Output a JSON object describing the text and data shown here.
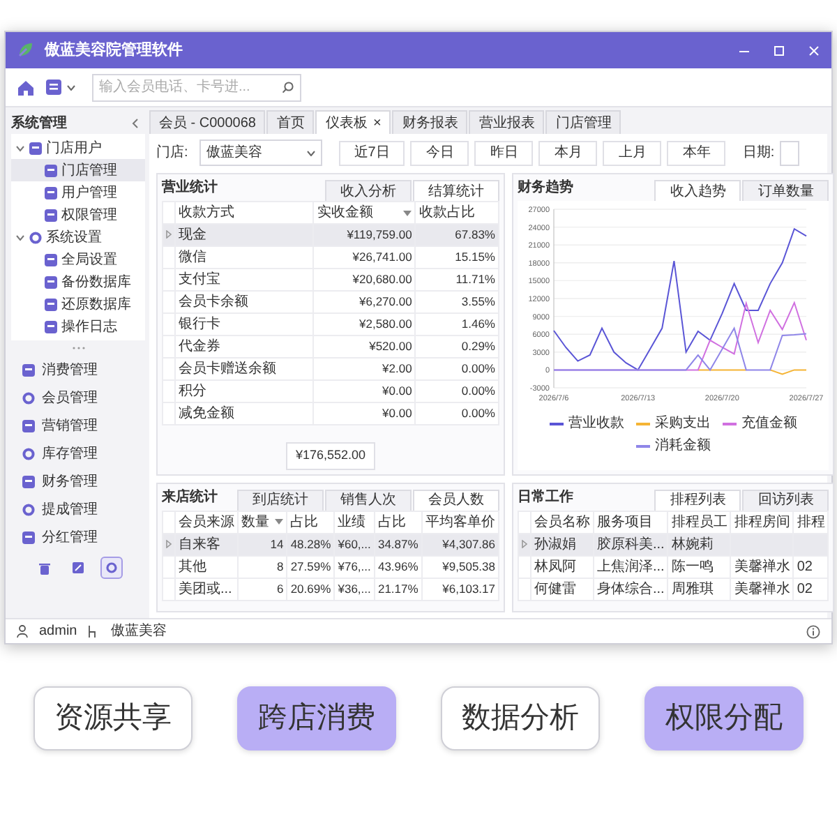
{
  "window": {
    "title": "傲蓝美容院管理软件"
  },
  "toolbar": {
    "search": {
      "placeholder": "输入会员电话、卡号进..."
    }
  },
  "sidebar": {
    "title": "系统管理",
    "tree": [
      {
        "label": "门店用户",
        "expanded": true,
        "selected": false,
        "children": [
          {
            "label": "门店管理",
            "selected": true
          },
          {
            "label": "用户管理",
            "selected": false
          },
          {
            "label": "权限管理",
            "selected": false
          }
        ]
      },
      {
        "label": "系统设置",
        "expanded": true,
        "selected": false,
        "children": [
          {
            "label": "全局设置",
            "selected": false
          },
          {
            "label": "备份数据库",
            "selected": false
          },
          {
            "label": "还原数据库",
            "selected": false
          },
          {
            "label": "操作日志",
            "selected": false
          }
        ]
      }
    ],
    "modules": [
      {
        "label": "消费管理",
        "selected": false
      },
      {
        "label": "会员管理",
        "selected": false
      },
      {
        "label": "营销管理",
        "selected": false
      },
      {
        "label": "库存管理",
        "selected": false
      },
      {
        "label": "财务管理",
        "selected": false
      },
      {
        "label": "提成管理",
        "selected": false
      },
      {
        "label": "分红管理",
        "selected": false
      }
    ],
    "footer_icons": [
      {
        "selected": false
      },
      {
        "selected": false
      },
      {
        "selected": true
      }
    ]
  },
  "doc_tabs": [
    {
      "label": "会员 - C000068",
      "selected": false
    },
    {
      "label": "首页",
      "selected": false
    },
    {
      "label": "仪表板",
      "selected": true,
      "close": "×"
    },
    {
      "label": "财务报表",
      "selected": false
    },
    {
      "label": "营业报表",
      "selected": false
    },
    {
      "label": "门店管理",
      "selected": false
    }
  ],
  "filter": {
    "store_label": "门店:",
    "store_value": "傲蓝美容",
    "ranges": [
      "近7日",
      "今日",
      "昨日",
      "本月",
      "上月",
      "本年"
    ],
    "date_label": "日期:"
  },
  "revenue": {
    "title": "营业统计",
    "tabs": [
      {
        "label": "收入分析",
        "selected": false
      },
      {
        "label": "结算统计",
        "selected": true
      }
    ],
    "columns": [
      {
        "label": "收款方式",
        "sorted": false
      },
      {
        "label": "实收金额",
        "sorted": true
      },
      {
        "label": "收款占比",
        "sorted": false
      }
    ],
    "rows": [
      {
        "selected": true,
        "cells": [
          "现金",
          "¥119,759.00",
          "67.83%"
        ]
      },
      {
        "selected": false,
        "cells": [
          "微信",
          "¥26,741.00",
          "15.15%"
        ]
      },
      {
        "selected": false,
        "cells": [
          "支付宝",
          "¥20,680.00",
          "11.71%"
        ]
      },
      {
        "selected": false,
        "cells": [
          "会员卡余额",
          "¥6,270.00",
          "3.55%"
        ]
      },
      {
        "selected": false,
        "cells": [
          "银行卡",
          "¥2,580.00",
          "1.46%"
        ]
      },
      {
        "selected": false,
        "cells": [
          "代金券",
          "¥520.00",
          "0.29%"
        ]
      },
      {
        "selected": false,
        "cells": [
          "会员卡赠送余额",
          "¥2.00",
          "0.00%"
        ]
      },
      {
        "selected": false,
        "cells": [
          "积分",
          "¥0.00",
          "0.00%"
        ]
      },
      {
        "selected": false,
        "cells": [
          "减免金额",
          "¥0.00",
          "0.00%"
        ]
      }
    ],
    "total": "¥176,552.00"
  },
  "trend": {
    "title": "财务趋势",
    "tabs": [
      {
        "label": "收入趋势",
        "selected": true
      },
      {
        "label": "订单数量",
        "selected": false
      }
    ],
    "chart_data": {
      "type": "line",
      "categories": [
        "2026/7/6",
        null,
        null,
        null,
        null,
        null,
        null,
        "2026/7/13",
        null,
        null,
        null,
        null,
        null,
        null,
        "2026/7/20",
        null,
        null,
        null,
        null,
        null,
        null,
        "2026/7/27"
      ],
      "grid": true,
      "legend": true,
      "ylim": [
        -3000,
        27000
      ],
      "yticks": [
        -3000,
        0,
        3000,
        6000,
        9000,
        12000,
        15000,
        18000,
        21000,
        24000,
        27000
      ],
      "series": [
        {
          "name": "营业收款",
          "color": "#5a55d6",
          "values": [
            6600,
            3800,
            1500,
            2500,
            7000,
            3000,
            1200,
            0,
            3500,
            7000,
            18300,
            3000,
            6500,
            5000,
            9500,
            14500,
            10000,
            10000,
            14500,
            18000,
            23700,
            22500
          ]
        },
        {
          "name": "采购支出",
          "color": "#f5b434",
          "values": [
            null,
            null,
            null,
            null,
            null,
            null,
            null,
            null,
            null,
            null,
            null,
            null,
            0,
            0,
            0,
            0,
            0,
            null,
            0,
            -700,
            0,
            0
          ]
        },
        {
          "name": "充值金额",
          "color": "#d070e0",
          "values": [
            0,
            0,
            0,
            0,
            0,
            0,
            0,
            0,
            0,
            0,
            0,
            0,
            0,
            5000,
            3800,
            2700,
            11200,
            4600,
            10000,
            6800,
            11300,
            5000
          ]
        },
        {
          "name": "消耗金额",
          "color": "#8f86e8",
          "values": [
            0,
            0,
            0,
            0,
            0,
            0,
            0,
            0,
            0,
            0,
            0,
            0,
            2500,
            0,
            3500,
            7000,
            0,
            0,
            0,
            5800,
            5900,
            6100
          ]
        }
      ]
    }
  },
  "visits": {
    "title": "来店统计",
    "tabs": [
      {
        "label": "到店统计",
        "selected": false
      },
      {
        "label": "销售人次",
        "selected": false
      },
      {
        "label": "会员人数",
        "selected": true
      }
    ],
    "columns": [
      {
        "label": "会员来源",
        "sorted": false
      },
      {
        "label": "数量",
        "sorted": true
      },
      {
        "label": "占比",
        "sorted": false
      },
      {
        "label": "业绩",
        "sorted": false
      },
      {
        "label": "占比",
        "sorted": false
      },
      {
        "label": "平均客单价",
        "sorted": false
      }
    ],
    "rows": [
      {
        "selected": true,
        "cells": [
          "自来客",
          "14",
          "48.28%",
          "¥60,...",
          "34.87%",
          "¥4,307.86"
        ]
      },
      {
        "selected": false,
        "cells": [
          "其他",
          "8",
          "27.59%",
          "¥76,...",
          "43.96%",
          "¥9,505.38"
        ]
      },
      {
        "selected": false,
        "cells": [
          "美团或...",
          "6",
          "20.69%",
          "¥36,...",
          "21.17%",
          "¥6,103.17"
        ]
      }
    ]
  },
  "schedule": {
    "title": "日常工作",
    "tabs": [
      {
        "label": "排程列表",
        "selected": true
      },
      {
        "label": "回访列表",
        "selected": false
      }
    ],
    "columns": [
      {
        "label": "会员名称",
        "sorted": false
      },
      {
        "label": "服务项目",
        "sorted": false
      },
      {
        "label": "排程员工",
        "sorted": false
      },
      {
        "label": "排程房间",
        "sorted": false
      },
      {
        "label": "排程",
        "sorted": false
      }
    ],
    "rows": [
      {
        "selected": true,
        "cells": [
          "孙淑娟",
          "胶原科美...",
          "林婉莉",
          null,
          null
        ]
      },
      {
        "selected": false,
        "cells": [
          "林凤阿",
          "上焦润泽...",
          "陈一鸣",
          "美馨禅水",
          "02"
        ]
      },
      {
        "selected": false,
        "cells": [
          "何健雷",
          "身体综合...",
          "周雅琪",
          "美馨禅水",
          "02"
        ]
      }
    ]
  },
  "status_bar": {
    "user": "admin",
    "store": "傲蓝美容"
  },
  "features": [
    {
      "label": "资源共享",
      "highlighted": false
    },
    {
      "label": "跨店消费",
      "highlighted": true
    },
    {
      "label": "数据分析",
      "highlighted": false
    },
    {
      "label": "权限分配",
      "highlighted": true
    }
  ]
}
